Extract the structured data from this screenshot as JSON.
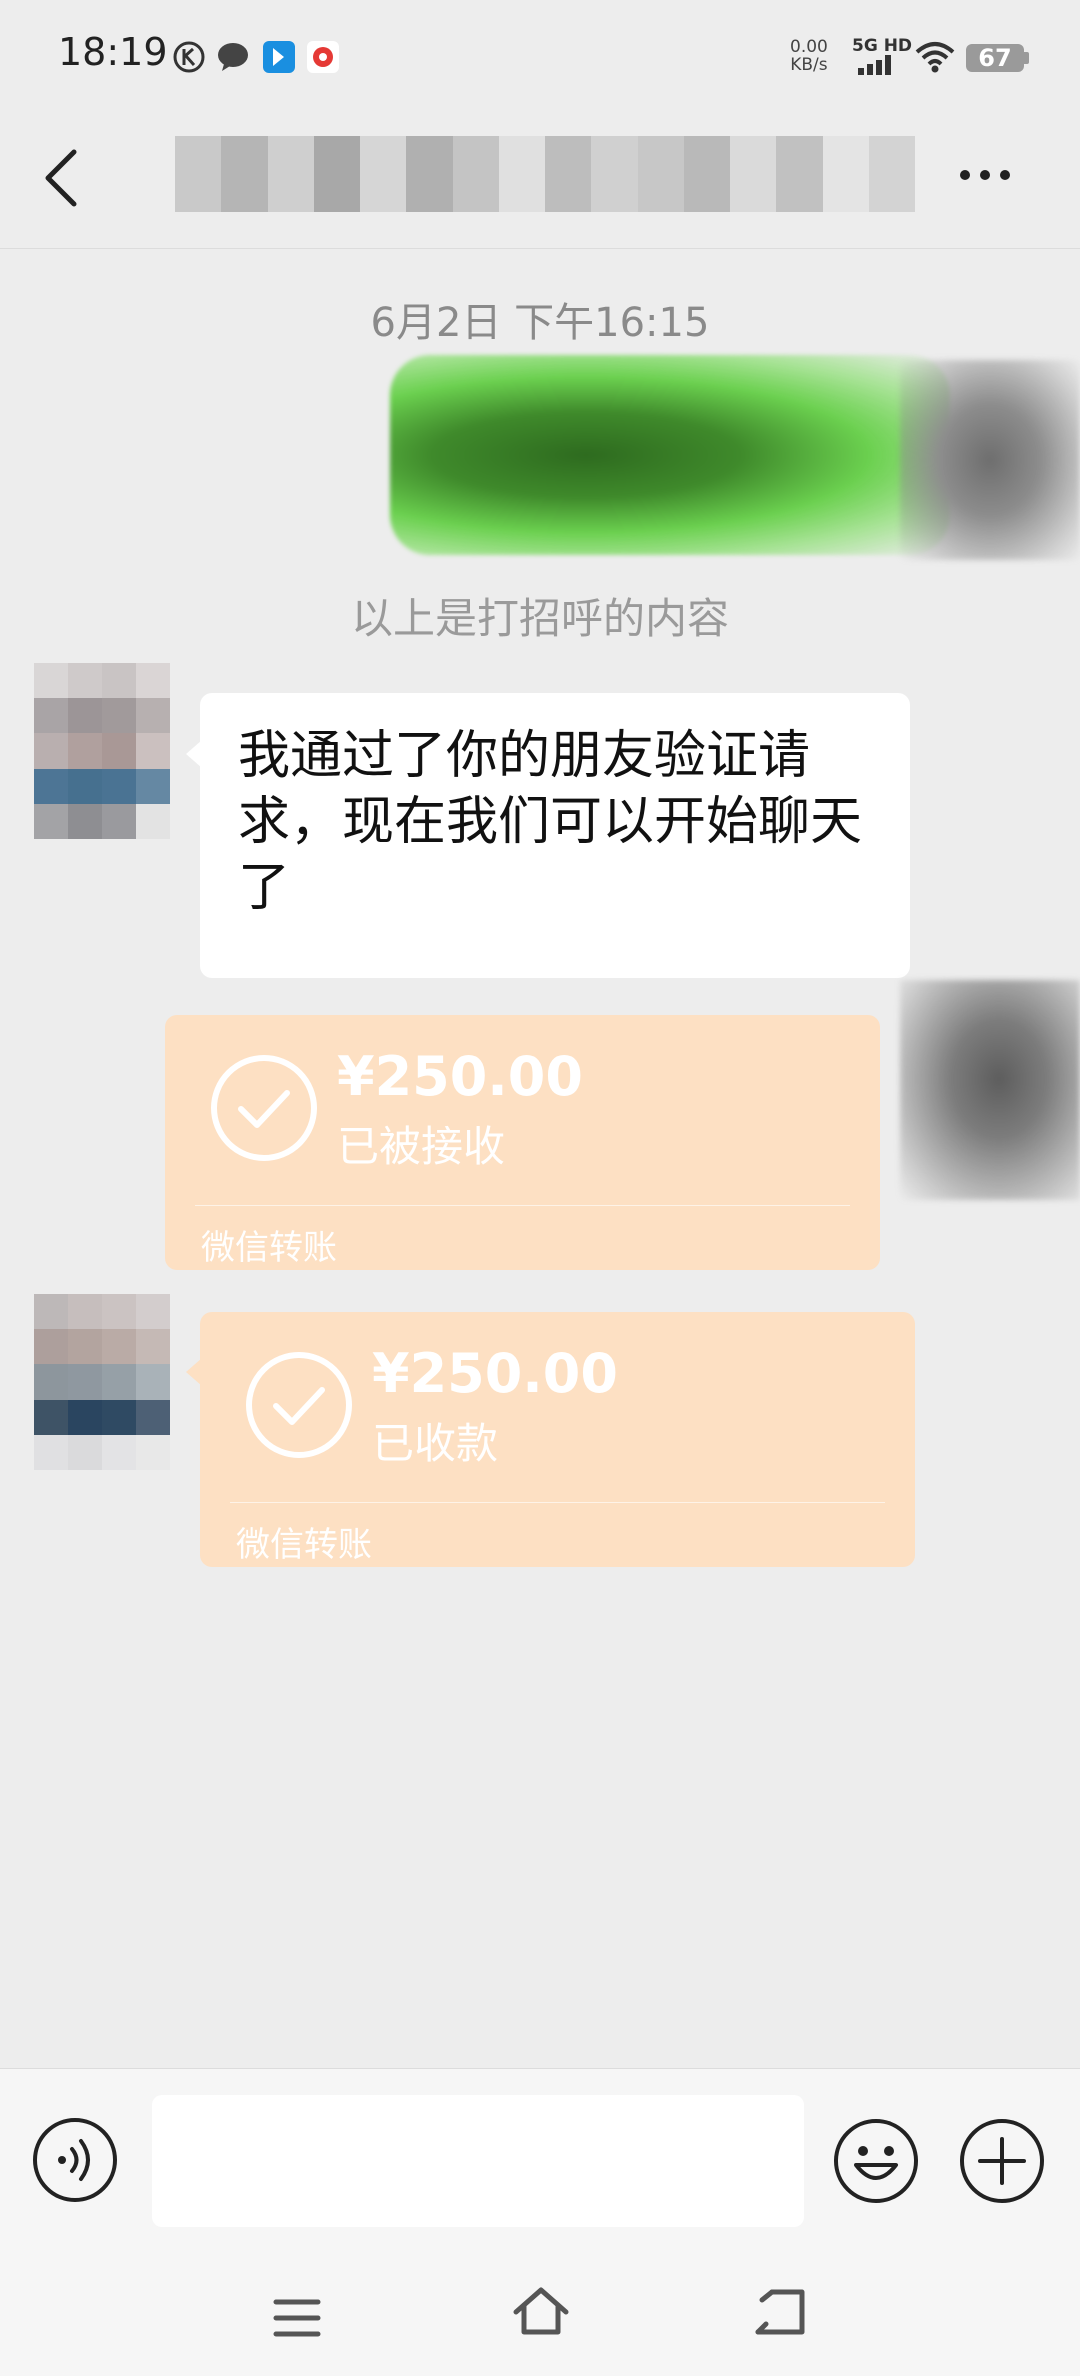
{
  "status_bar": {
    "time": "18:19",
    "net_speed_value": "0.00",
    "net_speed_unit": "KB/s",
    "signal_label": "5G HD",
    "battery": "67",
    "icons": [
      "k-badge-icon",
      "message-bubble-icon",
      "blue-app-icon",
      "red-app-icon",
      "signal-icon",
      "wifi-icon",
      "battery-icon"
    ]
  },
  "header": {
    "back_icon": "chevron-left-icon",
    "more_icon": "ellipsis-icon"
  },
  "chat": {
    "timestamp": "6月2日 下午16:15",
    "greeting_note": "以上是打招呼的内容",
    "message_1": "我通过了你的朋友验证请求，现在我们可以开始聊天了",
    "transfers": [
      {
        "amount": "¥250.00",
        "status": "已被接收",
        "label": "微信转账"
      },
      {
        "amount": "¥250.00",
        "status": "已收款",
        "label": "微信转账"
      }
    ]
  },
  "input_bar": {
    "voice_icon": "voice-icon",
    "emoji_icon": "emoji-icon",
    "plus_icon": "plus-icon",
    "input_value": ""
  },
  "nav": {
    "icons": [
      "menu-icon",
      "home-icon",
      "back-icon"
    ]
  },
  "colors": {
    "background": "#ededed",
    "transfer_card": "#fde0c3",
    "bubble": "#ffffff"
  }
}
